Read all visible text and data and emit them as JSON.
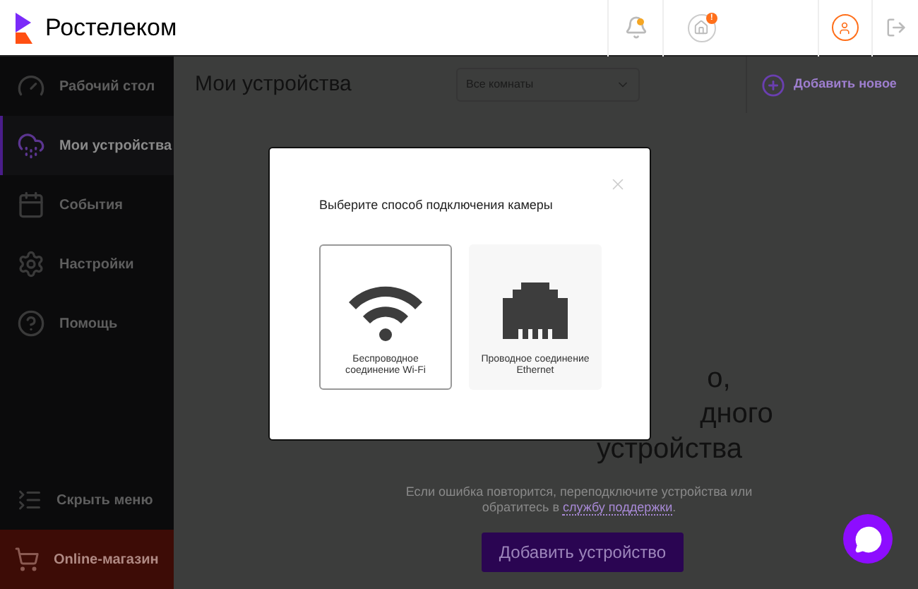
{
  "header": {
    "logo": "Ростелеком",
    "notifications": {
      "unread": true
    },
    "home": {
      "badge": "!"
    }
  },
  "sidebar": {
    "items": [
      {
        "label": "Рабочий стол",
        "selected": false
      },
      {
        "label": "Мои устройства",
        "selected": true
      },
      {
        "label": "События",
        "selected": false
      },
      {
        "label": "Настройки",
        "selected": false
      },
      {
        "label": "Помощь",
        "selected": false
      }
    ],
    "collapse": "Скрыть меню",
    "shop": "Online-магазин"
  },
  "main": {
    "title": "Мои устройства",
    "room_select": {
      "value": "Все комнаты"
    },
    "add_new": "Добавить новое",
    "heading_fragments": [
      "о,",
      "дного",
      "устройства"
    ],
    "hint_link": "службу поддержки",
    "hint_before": "Если ошибка повторится, переподключите устройства или обратитесь в ",
    "hint_after": ".",
    "add_button": "Добавить устройство"
  },
  "modal": {
    "title": "Выберите способ подключения камеры",
    "options": [
      {
        "kind": "wifi",
        "label": "Беспроводное соединение Wi-Fi",
        "selected": true
      },
      {
        "kind": "ethernet",
        "label": "Проводное соединение Ethernet",
        "selected": false
      }
    ]
  }
}
